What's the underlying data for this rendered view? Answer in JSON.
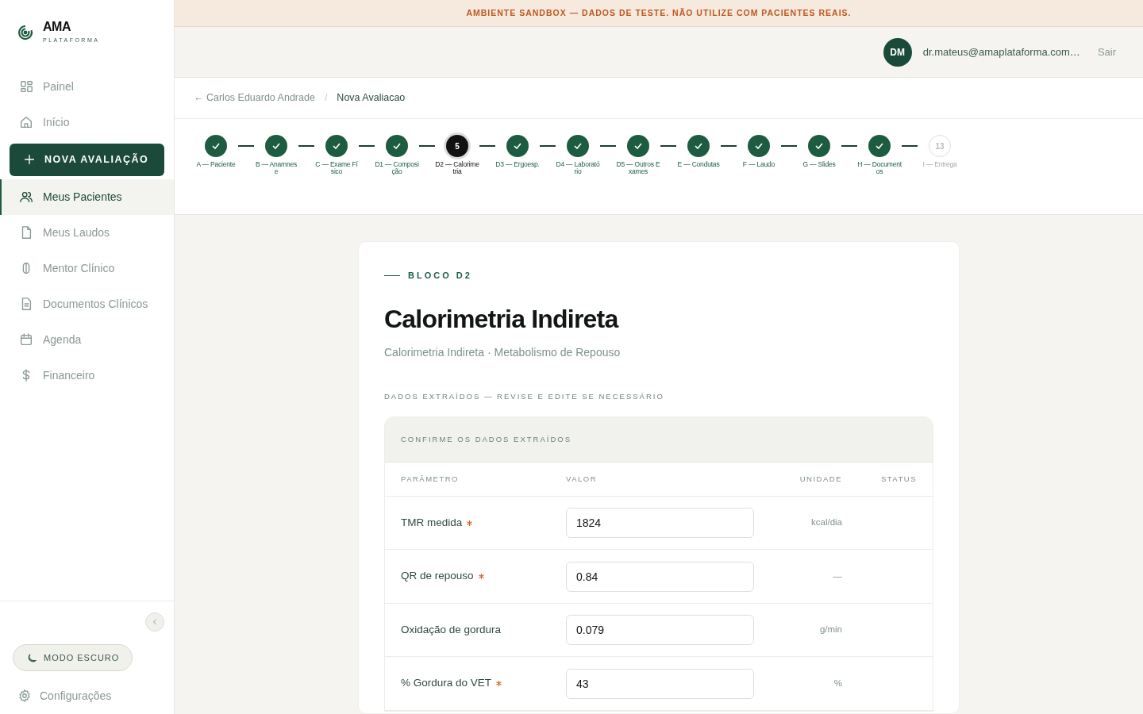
{
  "brand": {
    "name": "AMA",
    "tagline": "PLATAFORMA"
  },
  "sidebar": {
    "items": [
      {
        "kind": "link",
        "label": "Painel",
        "selected": false
      },
      {
        "kind": "link",
        "label": "Início",
        "selected": false
      },
      {
        "kind": "action",
        "label": "NOVA AVALIAÇÃO"
      },
      {
        "kind": "link",
        "label": "Meus Pacientes",
        "selected": true
      },
      {
        "kind": "link",
        "label": "Meus Laudos",
        "selected": false
      },
      {
        "kind": "link",
        "label": "Mentor Clínico",
        "selected": false
      },
      {
        "kind": "link",
        "label": "Documentos Clínicos",
        "selected": false
      },
      {
        "kind": "link",
        "label": "Agenda",
        "selected": false
      },
      {
        "kind": "link",
        "label": "Financeiro",
        "selected": false
      }
    ],
    "dark_mode_button": "MODO ESCURO",
    "settings": "Configurações"
  },
  "banner": "AMBIENTE SANDBOX — DADOS DE TESTE. NÃO UTILIZE COM PACIENTES REAIS.",
  "user": {
    "initials": "DM",
    "email": "dr.mateus@amaplataforma.com…",
    "logout": "Sair"
  },
  "breadcrumb": {
    "back": "← Carlos Eduardo Andrade",
    "separator": "/",
    "current": "Nova Avaliacao"
  },
  "steps": [
    {
      "label": "A — Paciente",
      "completed": true,
      "selected": false
    },
    {
      "label": "B — Anamnese",
      "completed": true,
      "selected": false
    },
    {
      "label": "C — Exame Físico",
      "completed": true,
      "selected": false
    },
    {
      "label": "D1 — Composição",
      "completed": true,
      "selected": false
    },
    {
      "label": "D2 — Calorimetria",
      "completed": false,
      "selected": true,
      "number": "5"
    },
    {
      "label": "D3 — Ergoesp.",
      "completed": true,
      "selected": false
    },
    {
      "label": "D4 — Laboratório",
      "completed": true,
      "selected": false
    },
    {
      "label": "D5 — Outros Exames",
      "completed": true,
      "selected": false
    },
    {
      "label": "E — Condutas",
      "completed": true,
      "selected": false
    },
    {
      "label": "F — Laudo",
      "completed": true,
      "selected": false
    },
    {
      "label": "G — Slides",
      "completed": true,
      "selected": false
    },
    {
      "label": "H — Documentos",
      "completed": true,
      "selected": false
    },
    {
      "label": "I — Entrega",
      "completed": false,
      "selected": false,
      "number": "13"
    }
  ],
  "block": {
    "eyebrow": "BLOCO D2",
    "title": "Calorimetria Indireta",
    "subtitle": "Calorimetria Indireta · Metabolismo de Repouso",
    "section_label": "DADOS EXTRAÍDOS — REVISE E EDITE SE NECESSÁRIO"
  },
  "table": {
    "heading": "CONFIRME OS DADOS EXTRAÍDOS",
    "columns": [
      "PARÂMETRO",
      "VALOR",
      "UNIDADE",
      "STATUS"
    ],
    "rows": [
      {
        "parameter": "TMR medida",
        "required": true,
        "value": "1824",
        "unit": "kcal/dia"
      },
      {
        "parameter": "QR de repouso",
        "required": true,
        "value": "0.84",
        "unit": "—"
      },
      {
        "parameter": "Oxidação de gordura",
        "required": false,
        "value": "0.079",
        "unit": "g/min"
      },
      {
        "parameter": "% Gordura do VET",
        "required": true,
        "value": "43",
        "unit": "%"
      }
    ]
  }
}
